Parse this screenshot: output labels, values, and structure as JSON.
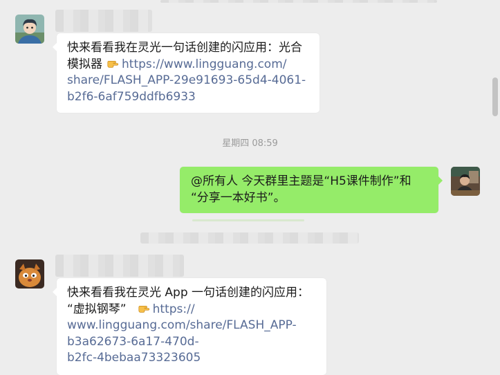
{
  "messages": [
    {
      "line1": "快来看看我在灵光一句话创建的闪应用：光合",
      "line2_text": "模拟器",
      "line2_link": "https://www.lingguang.com/",
      "line3": "share/FLASH_APP-29e91693-65d4-4061-",
      "line4": "b2f6-6af759ddfb6933"
    },
    {
      "line1": "@所有人 今天群里主题是“H5课件制作”和",
      "line2": "“分享一本好书”。"
    },
    {
      "line1": "快来看看我在灵光 App 一句话创建的闪应用：",
      "line2_text": "“虚拟钢琴”",
      "line2_link": "https://",
      "line3": "www.lingguang.com/share/FLASH_APP-",
      "line4": "b3a62673-6a17-470d-",
      "line5": "b2fc-4bebaa73323605"
    }
  ],
  "timestamp": "星期四 08:59",
  "icons": {
    "pointing_hand": "backhand-index-pointing-right-icon"
  },
  "colors": {
    "background": "#ededed",
    "bubble_incoming": "#ffffff",
    "bubble_outgoing": "#95ec69",
    "link": "#576b95",
    "timestamp": "#9a9a9a"
  }
}
